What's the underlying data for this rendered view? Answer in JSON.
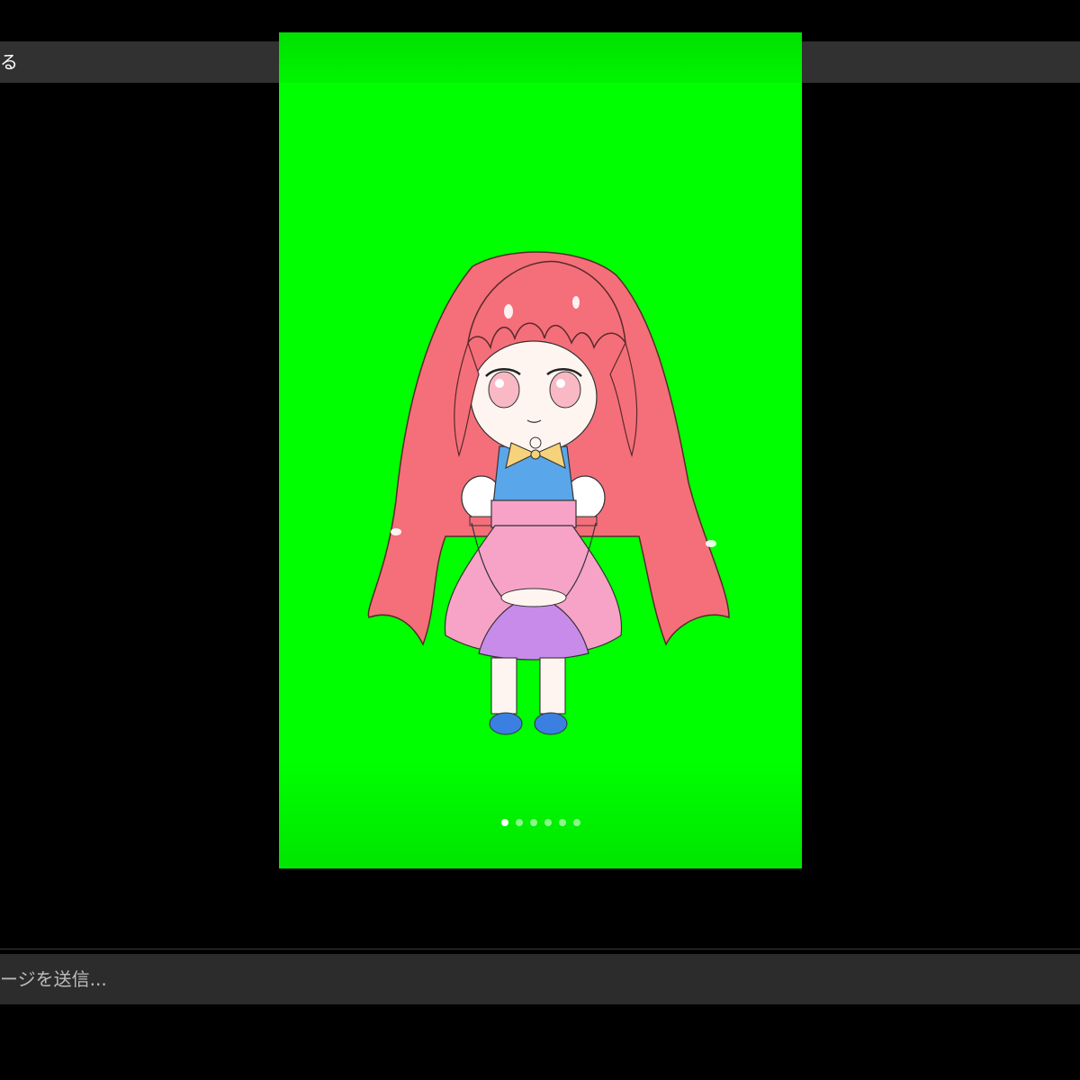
{
  "header": {
    "label": "る"
  },
  "story": {
    "background_color": "#00ff00",
    "page_count": 6,
    "active_page": 1
  },
  "composer": {
    "placeholder": "ージを送信..."
  },
  "colors": {
    "hair": "#f46f7a",
    "dress": "#f7a3c8",
    "collar": "#5aa6ea",
    "bow": "#f6d27a",
    "shoes": "#3b7fe0",
    "skirt_front": "#c98bea"
  }
}
